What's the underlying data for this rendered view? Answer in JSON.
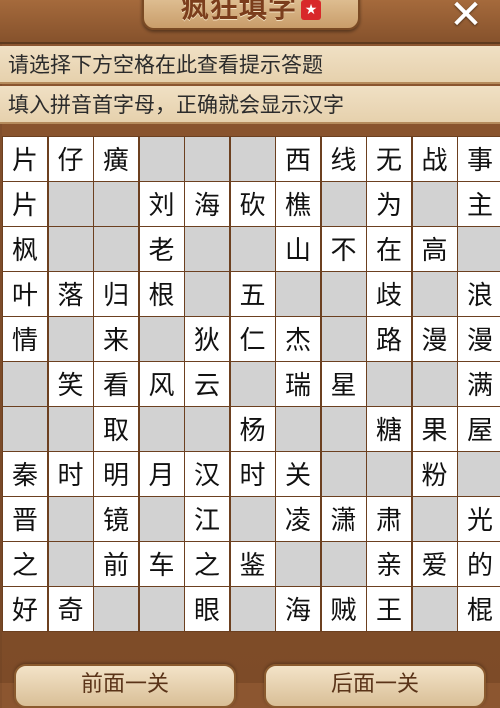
{
  "header": {
    "title": "疯狂填字",
    "badge": "★",
    "close": "✕"
  },
  "hints": [
    "请选择下方空格在此查看提示答题",
    "填入拼音首字母，正确就会显示汉字"
  ],
  "grid": [
    [
      "片",
      "仔",
      "癀",
      "_",
      "_",
      "_",
      "西",
      "线",
      "无",
      "战",
      "事"
    ],
    [
      "片",
      "_",
      "_",
      "刘",
      "海",
      "砍",
      "樵",
      "_",
      "为",
      "_",
      "主"
    ],
    [
      "枫",
      "_",
      "_",
      "老",
      "_",
      "_",
      "山",
      "不",
      "在",
      "高",
      "_"
    ],
    [
      "叶",
      "落",
      "归",
      "根",
      "_",
      "五",
      "_",
      "_",
      "歧",
      "_",
      "浪"
    ],
    [
      "情",
      "_",
      "来",
      "_",
      "狄",
      "仁",
      "杰",
      "_",
      "路",
      "漫",
      "漫"
    ],
    [
      "_",
      "笑",
      "看",
      "风",
      "云",
      "_",
      "瑞",
      "星",
      "_",
      "_",
      "满"
    ],
    [
      "_",
      "_",
      "取",
      "_",
      "_",
      "杨",
      "_",
      "_",
      "糖",
      "果",
      "屋"
    ],
    [
      "秦",
      "时",
      "明",
      "月",
      "汉",
      "时",
      "关",
      "_",
      "_",
      "粉",
      "_"
    ],
    [
      "晋",
      "_",
      "镜",
      "_",
      "江",
      "_",
      "凌",
      "潇",
      "肃",
      "_",
      "光"
    ],
    [
      "之",
      "_",
      "前",
      "车",
      "之",
      "鉴",
      "_",
      "_",
      "亲",
      "爱",
      "的"
    ],
    [
      "好",
      "奇",
      "_",
      "_",
      "眼",
      "_",
      "海",
      "贼",
      "王",
      "_",
      "棍"
    ]
  ],
  "nav": {
    "prev": "前面一关",
    "next": "后面一关"
  }
}
